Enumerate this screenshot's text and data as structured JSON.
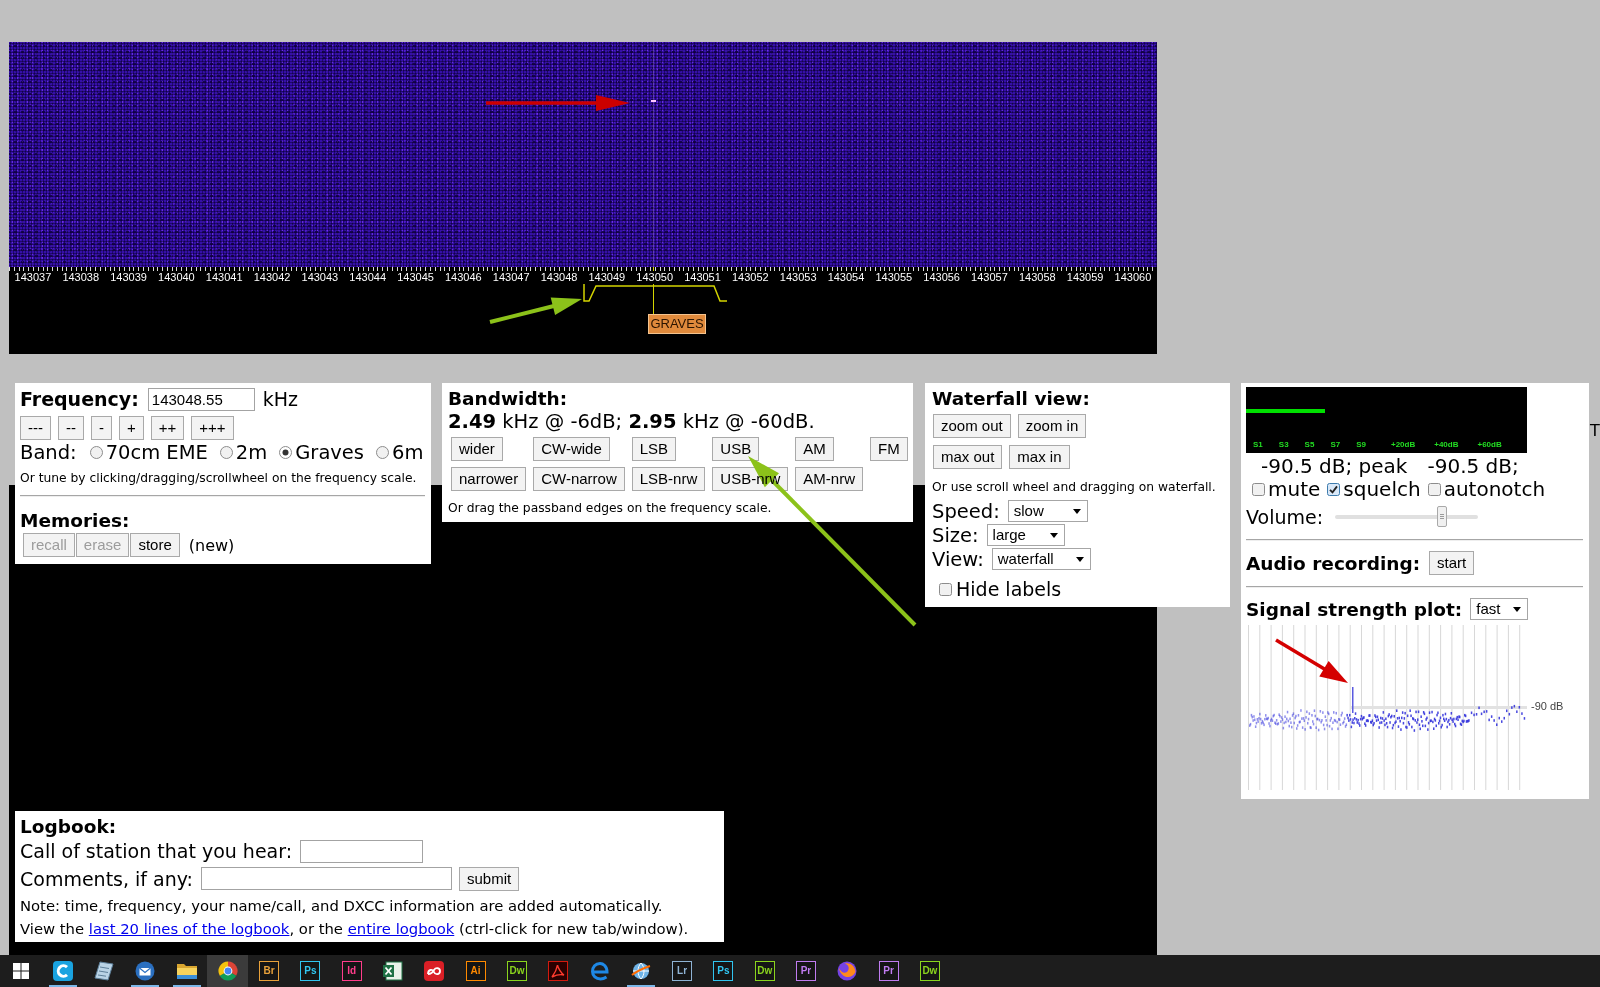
{
  "waterfall": {
    "scale_labels": [
      "143037",
      "143038",
      "143039",
      "143040",
      "143041",
      "143042",
      "143043",
      "143044",
      "143045",
      "143046",
      "143047",
      "143048",
      "143049",
      "143050",
      "143051",
      "143052",
      "143053",
      "143054",
      "143055",
      "143056",
      "143057",
      "143058",
      "143059",
      "143060"
    ],
    "station_label": "GRAVES"
  },
  "frequency_panel": {
    "title": "Frequency:",
    "value": "143048.55",
    "unit": "kHz",
    "step_buttons": [
      "---",
      "--",
      "-",
      "+",
      "++",
      "+++"
    ],
    "band_label": "Band:",
    "bands": [
      {
        "label": "70cm EME",
        "selected": false
      },
      {
        "label": "2m",
        "selected": false
      },
      {
        "label": "Graves",
        "selected": true
      },
      {
        "label": "6m",
        "selected": false
      }
    ],
    "hint": "Or tune by clicking/dragging/scrollwheel on the frequency scale.",
    "memories_title": "Memories:",
    "memory_buttons": [
      {
        "label": "recall",
        "disabled": true
      },
      {
        "label": "erase",
        "disabled": true
      },
      {
        "label": "store",
        "disabled": false
      }
    ],
    "memory_status": "(new)"
  },
  "bandwidth_panel": {
    "title": "Bandwidth:",
    "summary": "**2.49** kHz @ -6dB; **2.95** kHz @ -60dB.",
    "button_rows": [
      [
        "wider",
        "CW-wide",
        "LSB",
        "USB",
        "AM",
        "FM"
      ],
      [
        "narrower",
        "CW-narrow",
        "LSB-nrw",
        "USB-nrw",
        "AM-nrw"
      ]
    ],
    "hint": "Or drag the passband edges on the frequency scale."
  },
  "waterfall_panel": {
    "title": "Waterfall view:",
    "button_rows": [
      [
        "zoom out",
        "zoom in"
      ],
      [
        "max out",
        "max in"
      ]
    ],
    "hint": "Or use scroll wheel and dragging on waterfall.",
    "dropdowns": [
      {
        "label": "Speed:",
        "value": "slow"
      },
      {
        "label": "Size:",
        "value": "large"
      },
      {
        "label": "View:",
        "value": "waterfall"
      }
    ],
    "hide_labels": {
      "label": "Hide labels",
      "checked": false
    }
  },
  "audio_panel": {
    "s_meter": {
      "level": 0.28,
      "scale": [
        "S1",
        "S3",
        "S5",
        "S7",
        "S9",
        "+20dB",
        "+40dB",
        "+60dB"
      ]
    },
    "level_reading": "-90.5 dB; peak",
    "peak_reading": "-90.5 dB;",
    "toggles": [
      {
        "label": "mute",
        "checked": false
      },
      {
        "label": "squelch",
        "checked": true
      },
      {
        "label": "autonotch",
        "checked": false
      }
    ],
    "volume": {
      "label": "Volume:",
      "level": 0.75
    },
    "recording": {
      "title": "Audio recording:",
      "button": "start"
    },
    "signal_plot": {
      "title": "Signal strength plot:",
      "speed": "fast",
      "reference_label": "-90 dB"
    }
  },
  "edge_text": "T",
  "logbook": {
    "title": "Logbook:",
    "call_label": "Call of station that you hear:",
    "comments_label": "Comments, if any:",
    "submit": "submit",
    "note": "Note: time, frequency, your name/call, and DXCC information are added automatically.",
    "links_line": [
      {
        "kind": "text",
        "text": "View the "
      },
      {
        "kind": "link",
        "text": "last 20 lines of the logbook"
      },
      {
        "kind": "text",
        "text": ", or the "
      },
      {
        "kind": "link",
        "text": "entire logbook"
      },
      {
        "kind": "text",
        "text": " (ctrl-click for new tab/window)."
      }
    ]
  },
  "taskbar": {
    "items": [
      {
        "kind": "start",
        "running": false,
        "selected": false
      },
      {
        "kind": "ctile",
        "running": true,
        "selected": false
      },
      {
        "kind": "pad",
        "running": false,
        "selected": false
      },
      {
        "kind": "mail",
        "running": true,
        "selected": false
      },
      {
        "kind": "folder",
        "running": true,
        "selected": false
      },
      {
        "kind": "wheel",
        "running": false,
        "selected": true
      },
      {
        "kind": "letters",
        "label": "Br",
        "color": "#e8a13a",
        "running": false,
        "selected": false
      },
      {
        "kind": "letters",
        "label": "Ps",
        "color": "#31c5f0",
        "running": false,
        "selected": false
      },
      {
        "kind": "letters",
        "label": "Id",
        "color": "#ff3d8b",
        "running": false,
        "selected": false
      },
      {
        "kind": "sheet",
        "running": false,
        "selected": false
      },
      {
        "kind": "cloud",
        "running": false,
        "selected": false
      },
      {
        "kind": "letters",
        "label": "Ai",
        "color": "#ff8a00",
        "running": false,
        "selected": false
      },
      {
        "kind": "letters",
        "label": "Dw",
        "color": "#8ad41e",
        "running": false,
        "selected": false
      },
      {
        "kind": "pdf",
        "running": false,
        "selected": false
      },
      {
        "kind": "edge",
        "running": false,
        "selected": false
      },
      {
        "kind": "globe",
        "running": true,
        "selected": false
      },
      {
        "kind": "letters",
        "label": "Lr",
        "color": "#8fb3d4",
        "running": false,
        "selected": false
      },
      {
        "kind": "letters",
        "label": "Ps",
        "color": "#31c5f0",
        "running": false,
        "selected": false
      },
      {
        "kind": "letters",
        "label": "Dw",
        "color": "#8ad41e",
        "running": false,
        "selected": false
      },
      {
        "kind": "letters",
        "label": "Pr",
        "color": "#c07cf0",
        "running": false,
        "selected": false
      },
      {
        "kind": "fox",
        "running": false,
        "selected": false
      },
      {
        "kind": "letters",
        "label": "Pr",
        "color": "#c07cf0",
        "running": false,
        "selected": false
      },
      {
        "kind": "letters",
        "label": "Dw",
        "color": "#8ad41e",
        "running": false,
        "selected": false
      }
    ]
  }
}
